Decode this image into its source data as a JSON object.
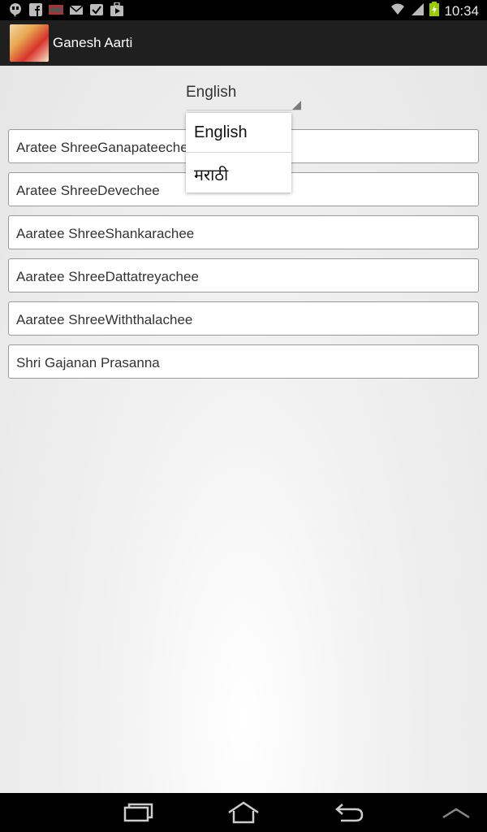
{
  "status_bar": {
    "time": "10:34",
    "icons": [
      "hangouts-icon",
      "facebook-icon",
      "ndtv-icon",
      "mail-icon",
      "checkmark-icon",
      "play-store-icon",
      "wifi-icon",
      "signal-icon",
      "battery-charging-icon"
    ]
  },
  "action_bar": {
    "title": "Ganesh Aarti",
    "icon": "ganesh-app-icon"
  },
  "spinner": {
    "selected": "English"
  },
  "dropdown": {
    "options": [
      "English",
      "मराठी"
    ]
  },
  "aarti_list": [
    "Aratee ShreeGanapateechee",
    "Aratee ShreeDevechee",
    "Aaratee ShreeShankarachee",
    "Aaratee ShreeDattatreyachee",
    "Aaratee ShreeWiththalachee",
    "Shri Gajanan Prasanna"
  ],
  "nav_bar": {
    "icons": [
      "recent-apps-icon",
      "home-icon",
      "back-icon",
      "chevron-up-icon"
    ]
  },
  "colors": {
    "status_bar": "#000000",
    "action_bar": "#1f1f1f",
    "content_bg": "#ececec",
    "list_border": "#9a9a9a"
  }
}
